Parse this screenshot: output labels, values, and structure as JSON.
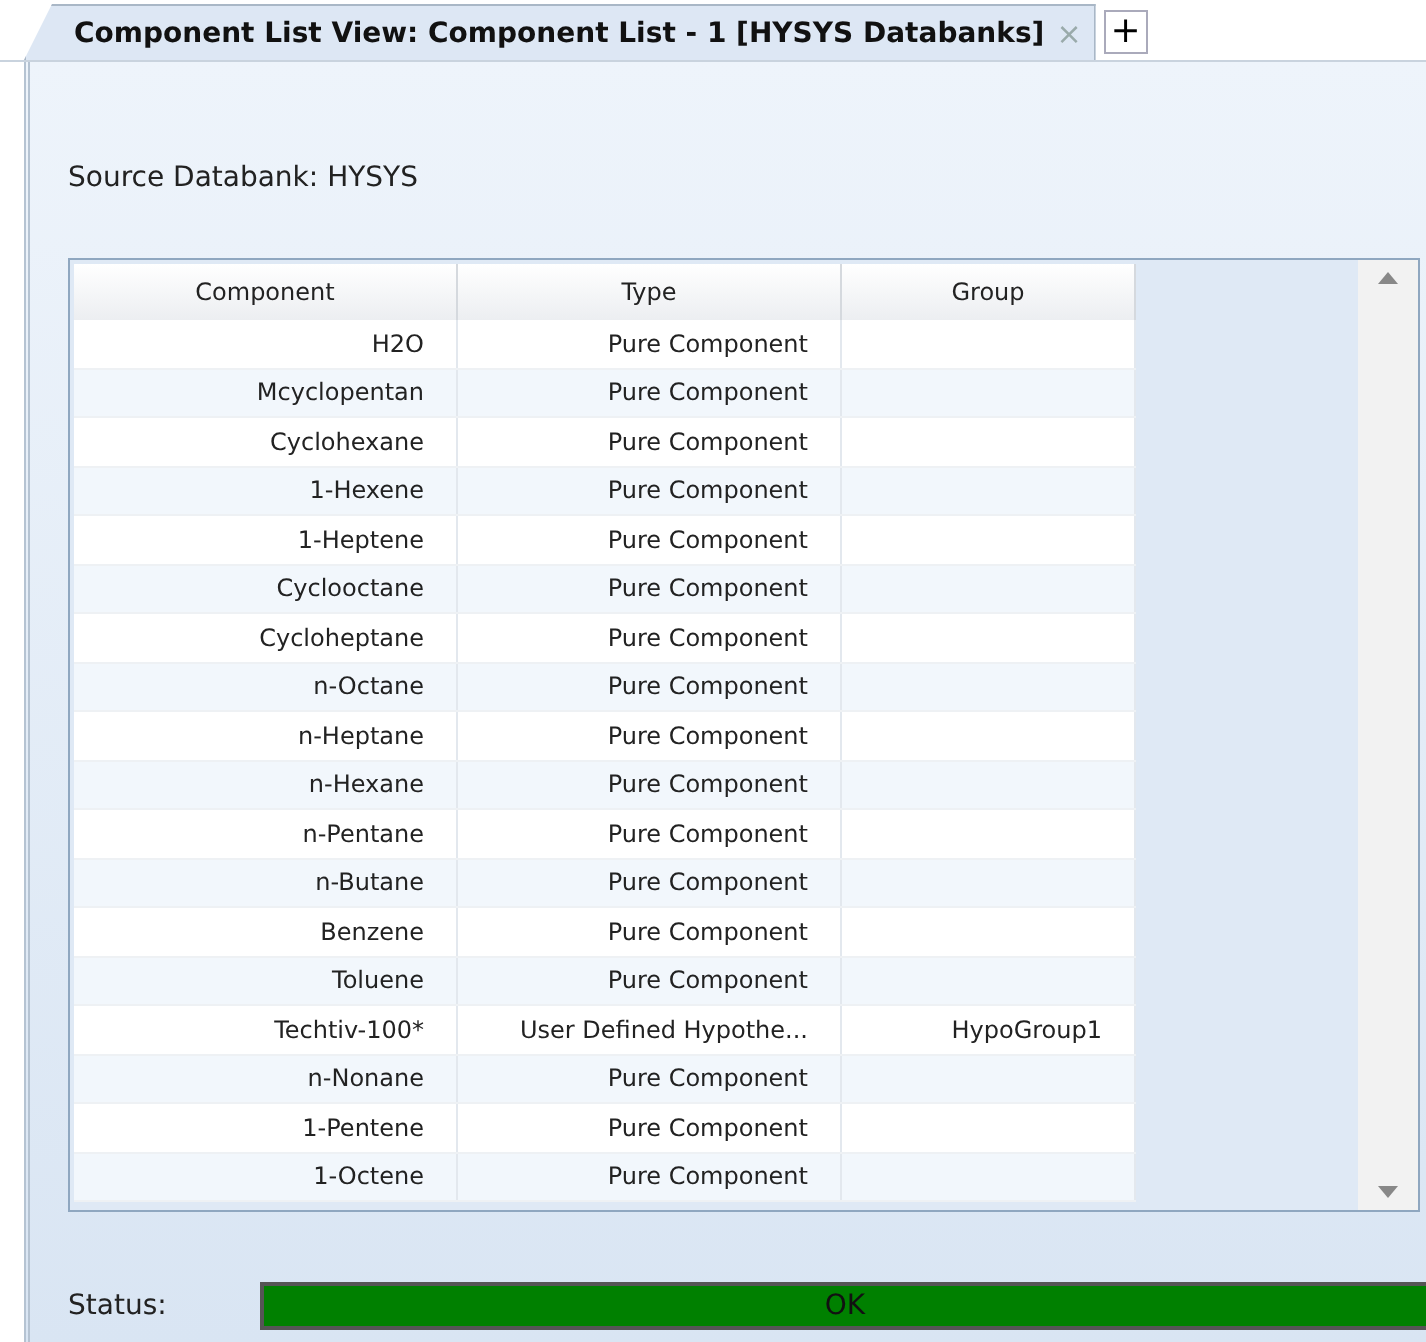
{
  "tabs": [
    {
      "label": "Component List View: Component List - 1 [HYSYS Databanks]",
      "close": "×",
      "selected": true
    }
  ],
  "new_tab": "+",
  "source_databank": "Source Databank: HYSYS",
  "table": {
    "columns": [
      "Component",
      "Type",
      "Group"
    ],
    "rows": [
      {
        "component": "H2O",
        "type": "Pure Component",
        "group": ""
      },
      {
        "component": "Mcyclopentan",
        "type": "Pure Component",
        "group": ""
      },
      {
        "component": "Cyclohexane",
        "type": "Pure Component",
        "group": ""
      },
      {
        "component": "1-Hexene",
        "type": "Pure Component",
        "group": ""
      },
      {
        "component": "1-Heptene",
        "type": "Pure Component",
        "group": ""
      },
      {
        "component": "Cyclooctane",
        "type": "Pure Component",
        "group": ""
      },
      {
        "component": "Cycloheptane",
        "type": "Pure Component",
        "group": ""
      },
      {
        "component": "n-Octane",
        "type": "Pure Component",
        "group": ""
      },
      {
        "component": "n-Heptane",
        "type": "Pure Component",
        "group": ""
      },
      {
        "component": "n-Hexane",
        "type": "Pure Component",
        "group": ""
      },
      {
        "component": "n-Pentane",
        "type": "Pure Component",
        "group": ""
      },
      {
        "component": "n-Butane",
        "type": "Pure Component",
        "group": ""
      },
      {
        "component": "Benzene",
        "type": "Pure Component",
        "group": ""
      },
      {
        "component": "Toluene",
        "type": "Pure Component",
        "group": ""
      },
      {
        "component": "Techtiv-100*",
        "type": "User Defined Hypothe...",
        "group": "HypoGroup1"
      },
      {
        "component": "n-Nonane",
        "type": "Pure Component",
        "group": ""
      },
      {
        "component": "1-Pentene",
        "type": "Pure Component",
        "group": ""
      },
      {
        "component": "1-Octene",
        "type": "Pure Component",
        "group": ""
      }
    ]
  },
  "status": {
    "label": "Status:",
    "value": "OK"
  }
}
